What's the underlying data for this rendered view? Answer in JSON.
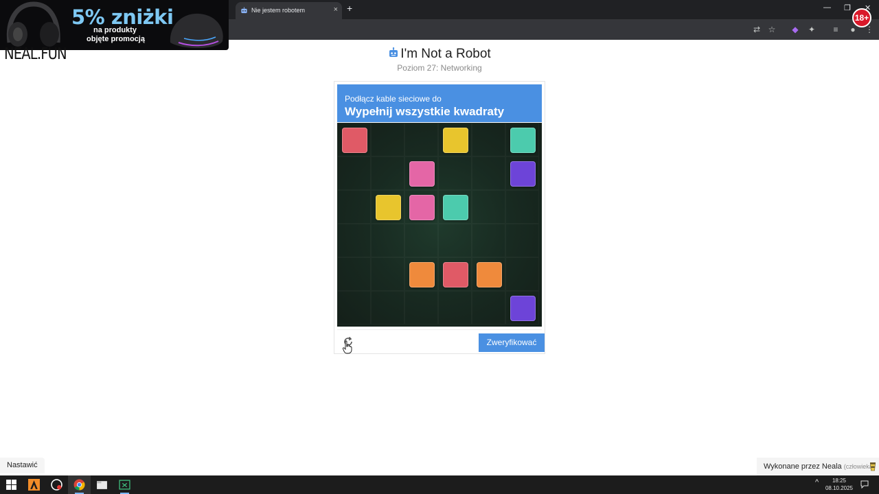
{
  "browser": {
    "tab_title": "Nie jestem robotem",
    "tab_close": "×",
    "new_tab": "+",
    "window_controls": [
      "—",
      "❐",
      "✕"
    ]
  },
  "ad": {
    "headline": "5% zniżki",
    "line1": "na produkty",
    "line2": "objęte promocją",
    "age_badge": "18+"
  },
  "site": {
    "logo": "NEAL.FUN",
    "title": "I'm Not a Robot",
    "subtitle": "Poziom 27: Networking"
  },
  "captcha": {
    "instruction_small": "Podłącz kable sieciowe do",
    "instruction_big": "Wypełnij wszystkie kwadraty",
    "verify_label": "Zweryfikować",
    "tiles": [
      {
        "row": 0,
        "col": 0,
        "color": "#e05a66"
      },
      {
        "row": 0,
        "col": 3,
        "color": "#e8c52d"
      },
      {
        "row": 0,
        "col": 5,
        "color": "#4ccbad"
      },
      {
        "row": 1,
        "col": 2,
        "color": "#e466a6"
      },
      {
        "row": 1,
        "col": 5,
        "color": "#6d44d8"
      },
      {
        "row": 2,
        "col": 1,
        "color": "#e8c52d"
      },
      {
        "row": 2,
        "col": 2,
        "color": "#e466a6"
      },
      {
        "row": 2,
        "col": 3,
        "color": "#4ccbad"
      },
      {
        "row": 4,
        "col": 2,
        "color": "#ef8a3c"
      },
      {
        "row": 4,
        "col": 3,
        "color": "#e05a66"
      },
      {
        "row": 4,
        "col": 4,
        "color": "#ef8a3c"
      },
      {
        "row": 5,
        "col": 5,
        "color": "#6d44d8"
      }
    ]
  },
  "footer": {
    "adjust_label": "Nastawić",
    "credit_text": "Wykonane przez Neala",
    "credit_muted": "(człowieka)"
  },
  "taskbar": {
    "time": "18:25",
    "date": "08.10.2025",
    "tray_chevron": "^"
  },
  "colors": {
    "accent": "#4a90e2",
    "grid_bg": "#182a21"
  }
}
